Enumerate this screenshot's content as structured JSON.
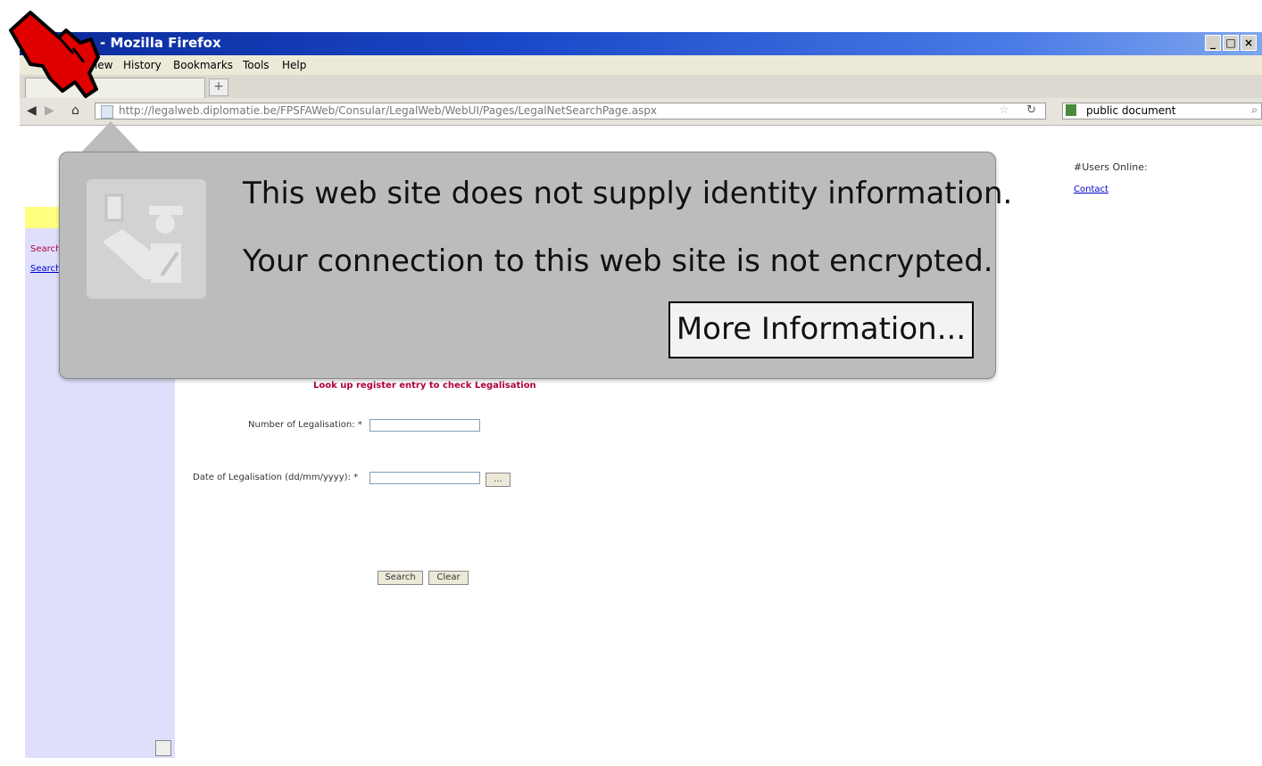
{
  "window": {
    "title": "- Mozilla Firefox",
    "controls": [
      "_",
      "□",
      "×"
    ]
  },
  "menu": [
    "View",
    "History",
    "Bookmarks",
    "Tools",
    "Help"
  ],
  "tab": {
    "new_tab_label": "+"
  },
  "navbar": {
    "url": "http://legalweb.diplomatie.be/FPSFAWeb/Consular/LegalWeb/WebUI/Pages/LegalNetSearchPage.aspx",
    "search_value": "public document"
  },
  "popup": {
    "identity_text": "This web site does not supply identity information.",
    "encryption_text": "Your connection to this web site is not encrypted.",
    "more_info_label": "More Information..."
  },
  "page": {
    "users_online": "#Users Online:",
    "contact": "Contact",
    "sidebar_links": [
      "Search",
      "Search"
    ],
    "form_heading": "Look up register entry to check Legalisation",
    "number_label": "Number of Legalisation: *",
    "date_label": "Date of Legalisation (dd/mm/yyyy): *",
    "calendar_button": "...",
    "search_button": "Search",
    "clear_button": "Clear"
  },
  "icons": [
    "firefox-icon",
    "back-icon",
    "forward-icon",
    "home-icon",
    "site-identity-icon",
    "star-icon",
    "reload-icon",
    "google-icon",
    "search-icon",
    "identity-officer-icon",
    "hand-cursor-icon"
  ],
  "colors": {
    "titlebar": "#0b2a9a",
    "popup": "#bcbcbc",
    "sidebar": "#dfdffc",
    "heading": "#b00040",
    "cursor": "#e00000"
  }
}
